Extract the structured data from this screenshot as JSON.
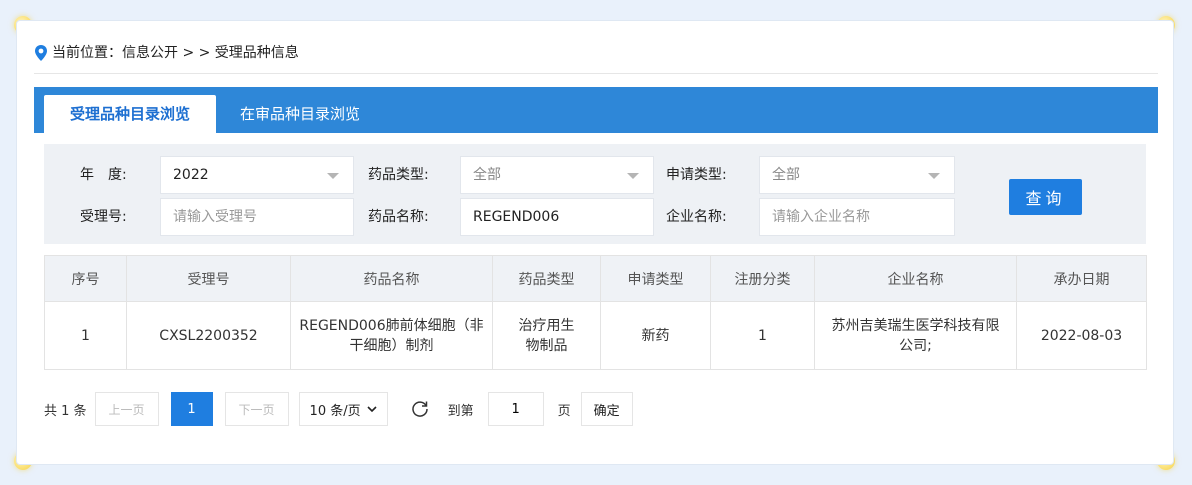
{
  "breadcrumb": {
    "text": "当前位置：信息公开 > > 受理品种信息"
  },
  "tabs": [
    {
      "label": "受理品种目录浏览"
    },
    {
      "label": "在审品种目录浏览"
    }
  ],
  "filters": {
    "year_label": "年　度:",
    "year_value": "2022",
    "drug_type_label": "药品类型:",
    "drug_type_value": "全部",
    "apply_type_label": "申请类型:",
    "apply_type_value": "全部",
    "accept_no_label": "受理号:",
    "accept_no_placeholder": "请输入受理号",
    "drug_name_label": "药品名称:",
    "drug_name_value": "REGEND006",
    "company_label": "企业名称:",
    "company_placeholder": "请输入企业名称",
    "query_button": "查询"
  },
  "table": {
    "headers": [
      "序号",
      "受理号",
      "药品名称",
      "药品类型",
      "申请类型",
      "注册分类",
      "企业名称",
      "承办日期"
    ],
    "rows": [
      [
        "1",
        "CXSL2200352",
        "REGEND006肺前体细胞（非干细胞）制剂",
        "治疗用生物制品",
        "新药",
        "1",
        "苏州吉美瑞生医学科技有限公司;",
        "2022-08-03"
      ]
    ]
  },
  "pagination": {
    "total": "共 1 条",
    "prev": "上一页",
    "current_page": "1",
    "next": "下一页",
    "page_size": "10 条/页",
    "goto_label": "到第",
    "goto_value": "1",
    "page_unit": "页",
    "confirm": "确定"
  },
  "colors": {
    "accent": "#1f7ee0",
    "tabbar": "#2e87d8",
    "dot": "#f5d24a"
  },
  "icons": [
    "location-pin-icon",
    "chevron-down-icon",
    "refresh-icon"
  ]
}
